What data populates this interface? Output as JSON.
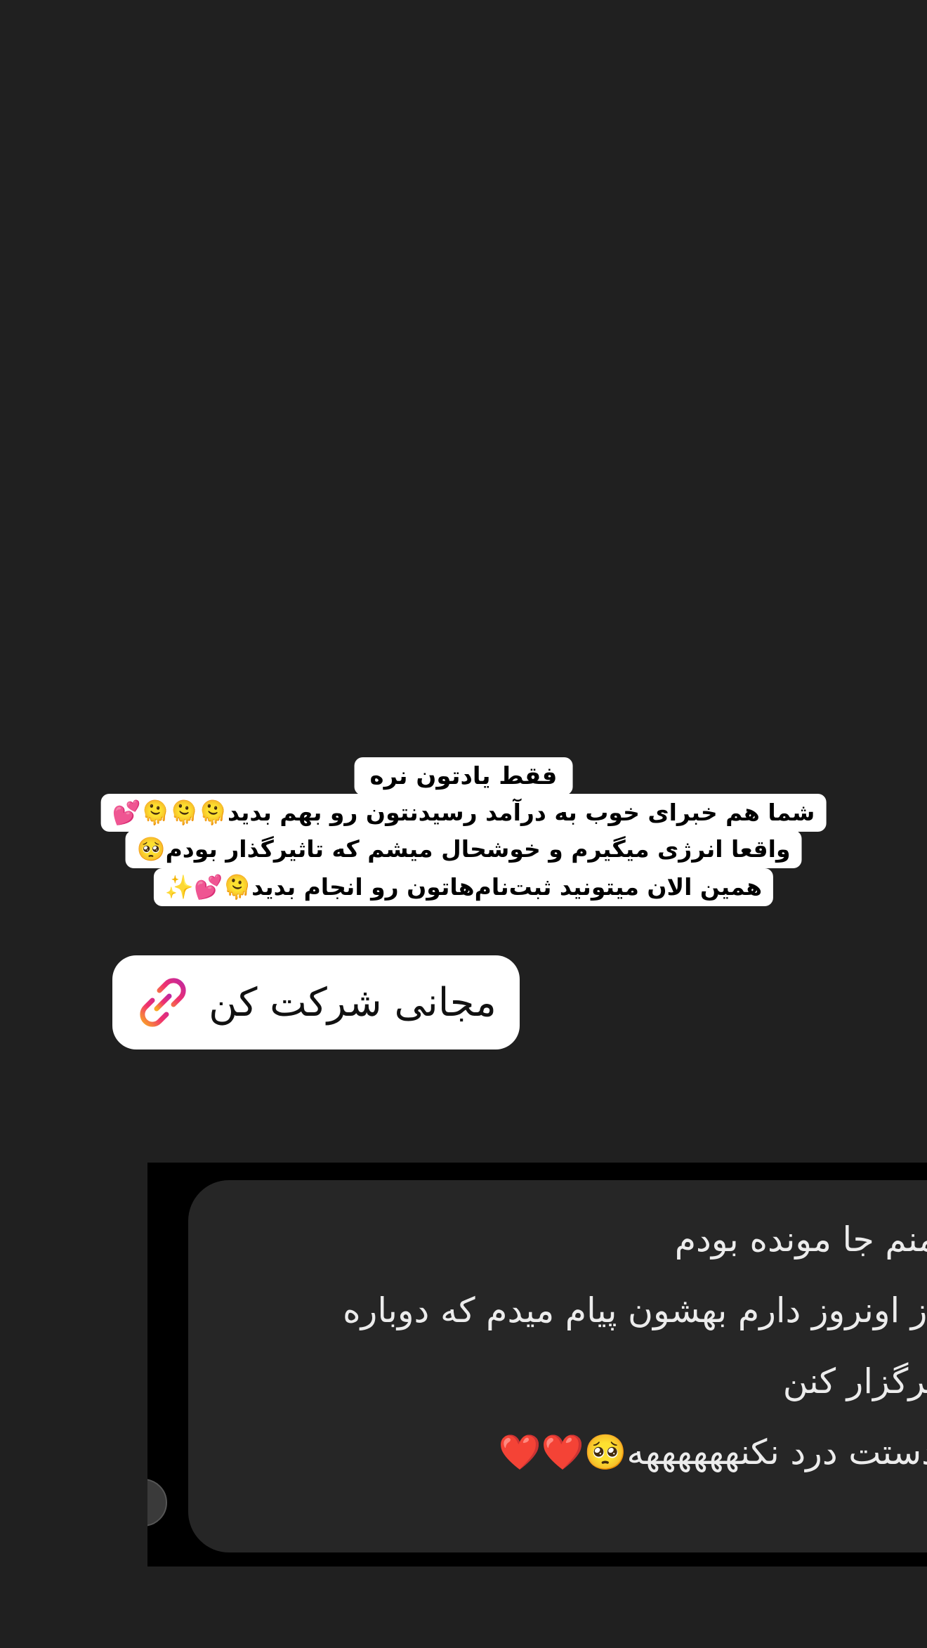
{
  "caption": {
    "line1": "فقط یادتون نره",
    "line2": "شما هم خبرای خوب به درآمد رسیدنتون رو بهم بدید🫠🫠🫠💕",
    "line3": "واقعا انرژی میگیرم و خوشحال میشم که تاثیرگذار بودم🥺",
    "line4": "همین الان میتونید ثبت‌نام‌هاتون رو انجام بدید🫠💕✨"
  },
  "link_sticker": {
    "label": "مجانی شرکت کن",
    "icon": "link-icon"
  },
  "chat_message": {
    "lines": [
      "منم جا مونده بودم",
      "از اونروز دارم بهشون پیام میدم که دوباره",
      "برگزار کنن",
      "دستت درد نکنههههههه🥺❤️❤️"
    ]
  },
  "colors": {
    "background": "#202020",
    "caption_bg": "#ffffff",
    "bubble_bg": "#262626",
    "screenshot_bg": "#000000",
    "link_gradient_start": "#f9a825",
    "link_gradient_end": "#d81b8c"
  }
}
